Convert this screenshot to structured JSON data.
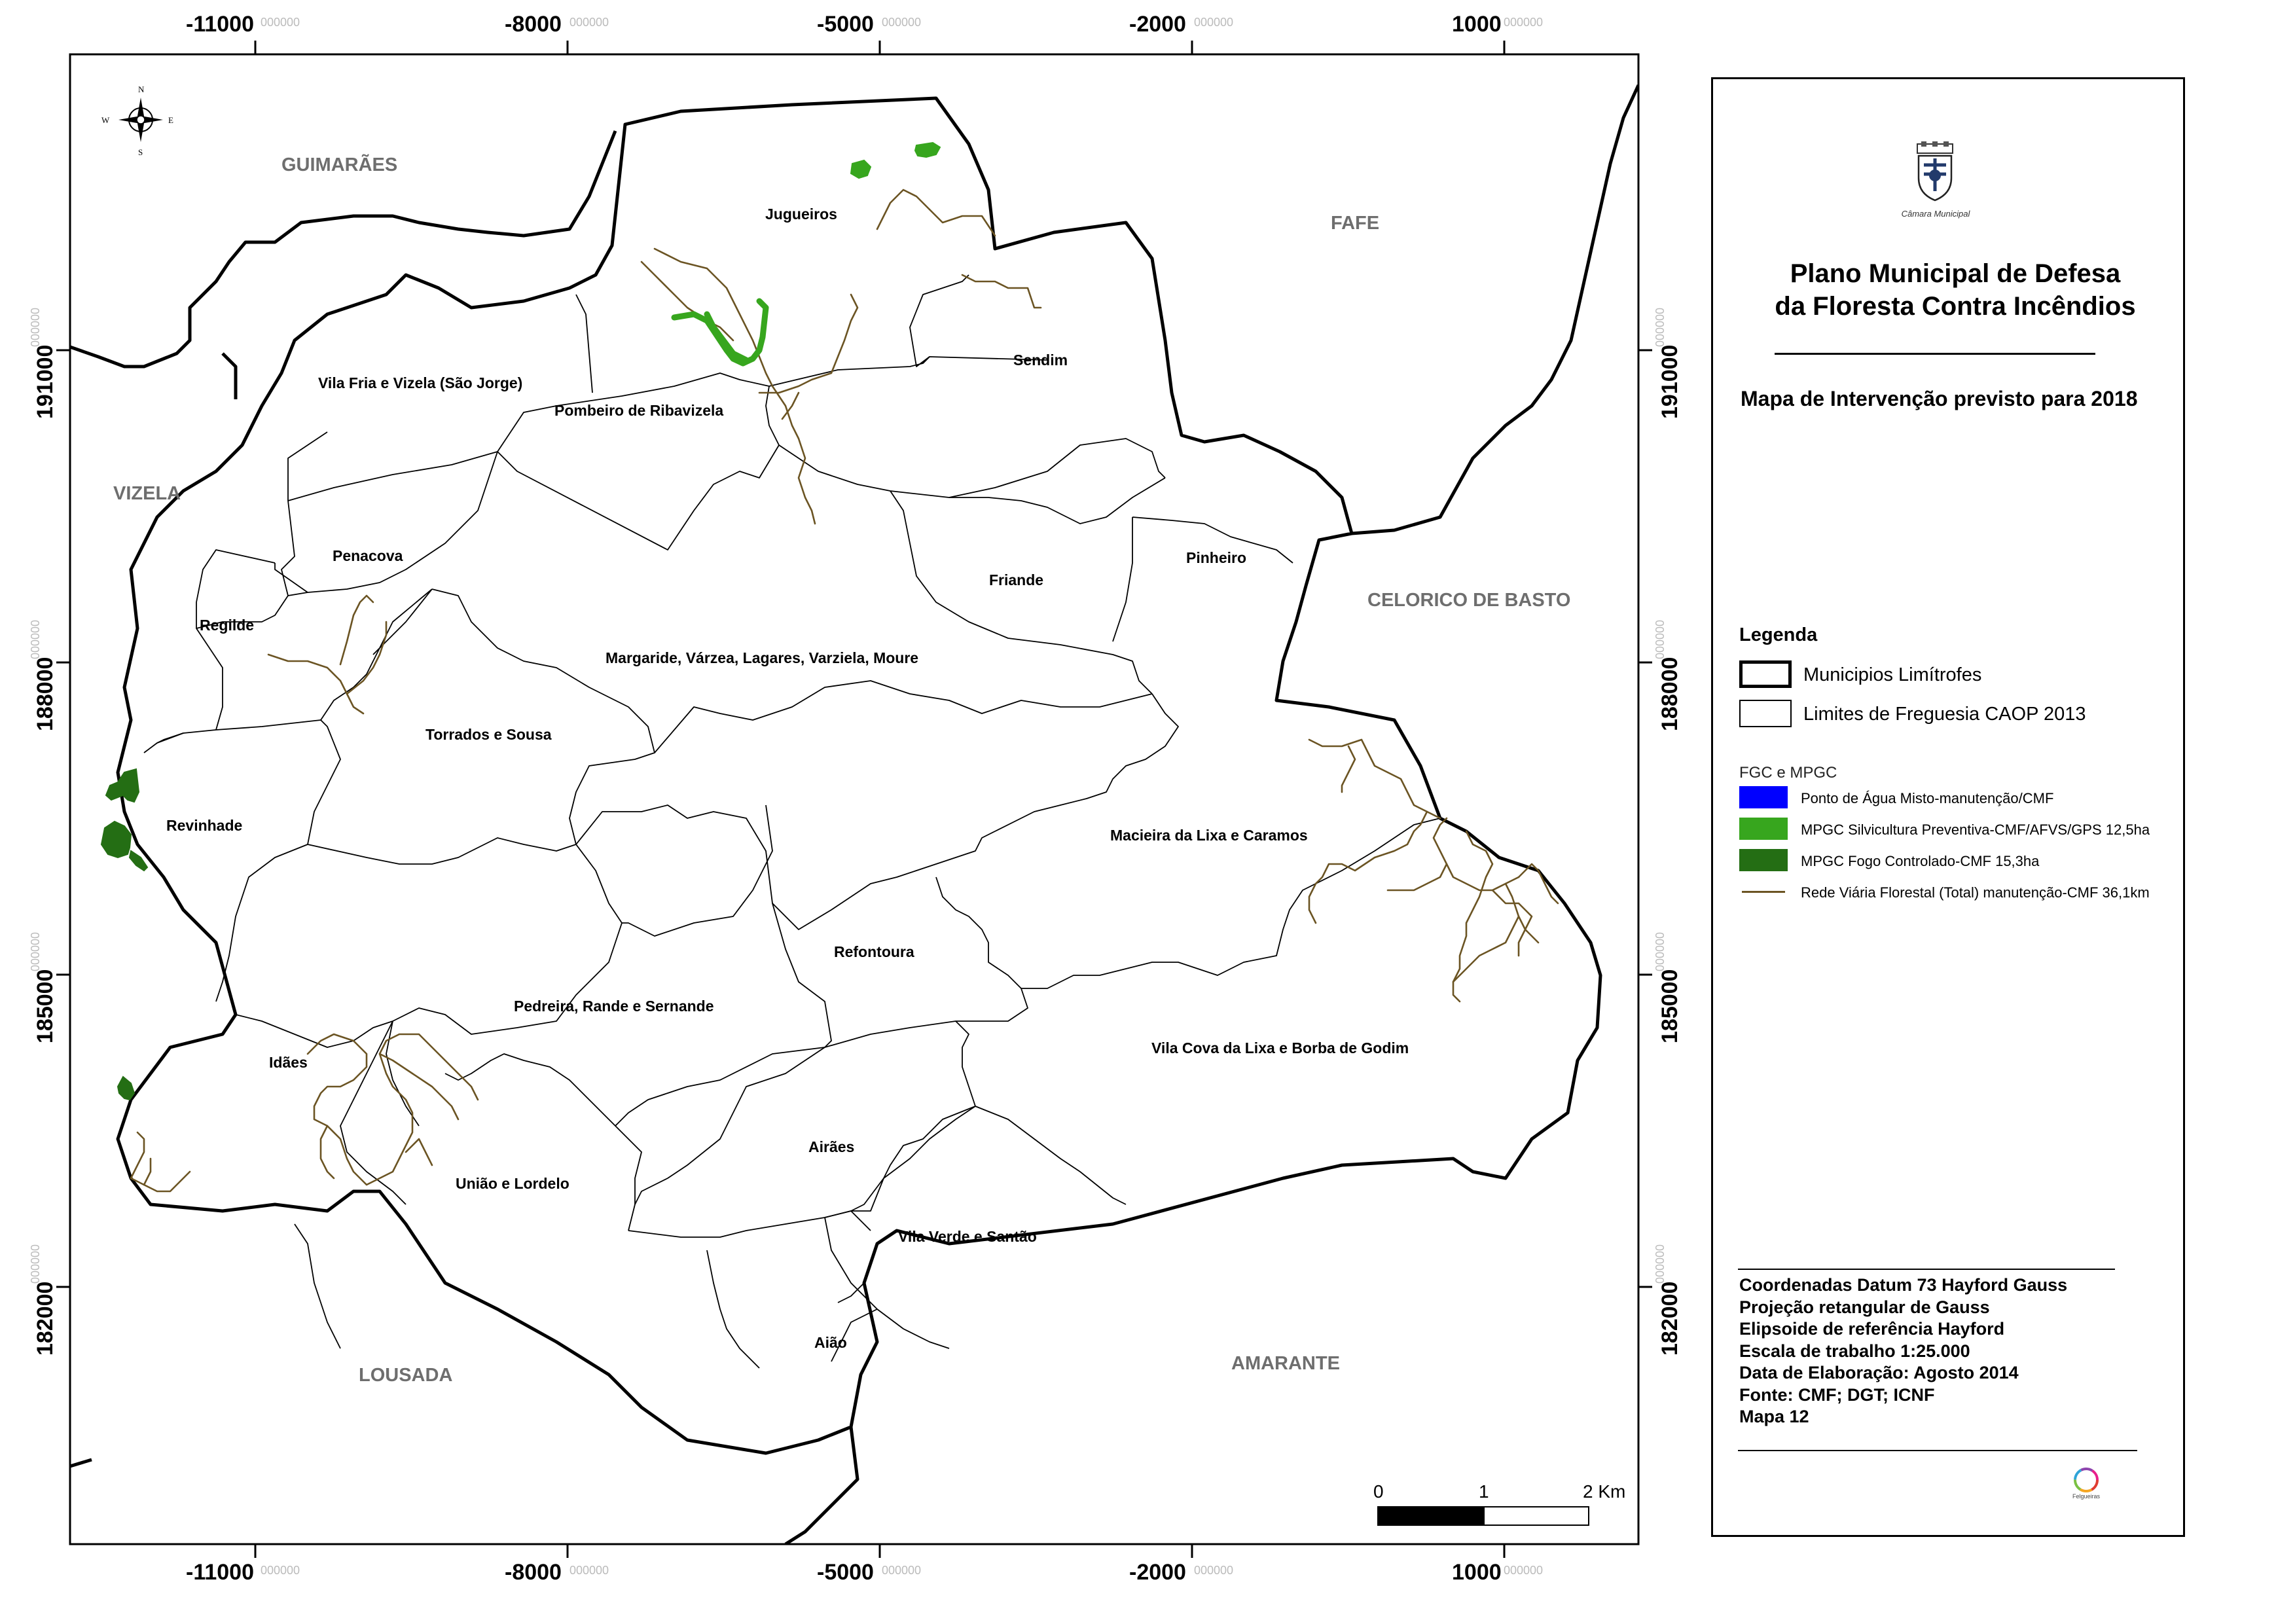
{
  "colors": {
    "ponto_agua": "#0000ff",
    "silvicultura": "#37a61e",
    "fogo_controlado": "#246e14",
    "rede_viaria": "#6b5423",
    "neighbor_label": "#6e6e6e"
  },
  "compass": {
    "n": "N",
    "s": "S",
    "e": "E",
    "w": "W"
  },
  "axes": {
    "x_ticks": [
      "-11000",
      "-8000",
      "-5000",
      "-2000",
      "1000"
    ],
    "y_ticks": [
      "191000",
      "188000",
      "185000",
      "182000"
    ],
    "suffix": "000000"
  },
  "neighbors": {
    "guimaraes": "GUIMARÃES",
    "fafe": "FAFE",
    "vizela": "VIZELA",
    "celorico": "CELORICO DE BASTO",
    "lousada": "LOUSADA",
    "amarante": "AMARANTE"
  },
  "parishes": {
    "jugueiros": "Jugueiros",
    "sendim": "Sendim",
    "vila_fria": "Vila Fria e Vizela (São Jorge)",
    "pombeiro": "Pombeiro de Ribavizela",
    "penacova": "Penacova",
    "friande": "Friande",
    "pinheiro": "Pinheiro",
    "regilde": "Regilde",
    "margaride": "Margaride, Várzea, Lagares, Varziela, Moure",
    "torrados": "Torrados e Sousa",
    "revinhade": "Revinhade",
    "macieira": "Macieira da Lixa e Caramos",
    "refontoura": "Refontoura",
    "pedreira": "Pedreira, Rande e Sernande",
    "idaes": "Idães",
    "vila_cova": "Vila Cova da Lixa e Borba de Godim",
    "airaes": "Airães",
    "uniao": "União e Lordelo",
    "vila_verde": "Vila Verde e Santão",
    "aiao": "Aião"
  },
  "scale": {
    "zero": "0",
    "one": "1",
    "two": "2 Km"
  },
  "panel": {
    "org": "Câmara Municipal",
    "title_line1": "Plano Municipal de Defesa",
    "title_line2": "da Floresta Contra Incêndios",
    "subtitle": "Mapa de Intervenção previsto para 2018",
    "legend_title": "Legenda",
    "legend": {
      "municipios": "Municipios Limítrofes",
      "freguesias": "Limites de Freguesia CAOP 2013"
    },
    "fgc_title": "FGC e MPGC",
    "fgc_items": {
      "ponto": "Ponto de Água Misto-manutenção/CMF",
      "silv": "MPGC Silvicultura Preventiva-CMF/AFVS/GPS 12,5ha",
      "fogo": "MPGC Fogo Controlado-CMF 15,3ha",
      "rede": "Rede Viária Florestal (Total) manutenção-CMF 36,1km"
    },
    "meta": {
      "l1": "Coordenadas Datum 73 Hayford Gauss",
      "l2": "Projeção retangular de Gauss",
      "l3": "Elipsoide de referência Hayford",
      "l4": "Escala de trabalho 1:25.000",
      "l5": "Data de Elaboração: Agosto 2014",
      "l6": "Fonte: CMF; DGT; ICNF",
      "l7": "Mapa 12"
    },
    "footer_logo": "Felgueiras"
  }
}
